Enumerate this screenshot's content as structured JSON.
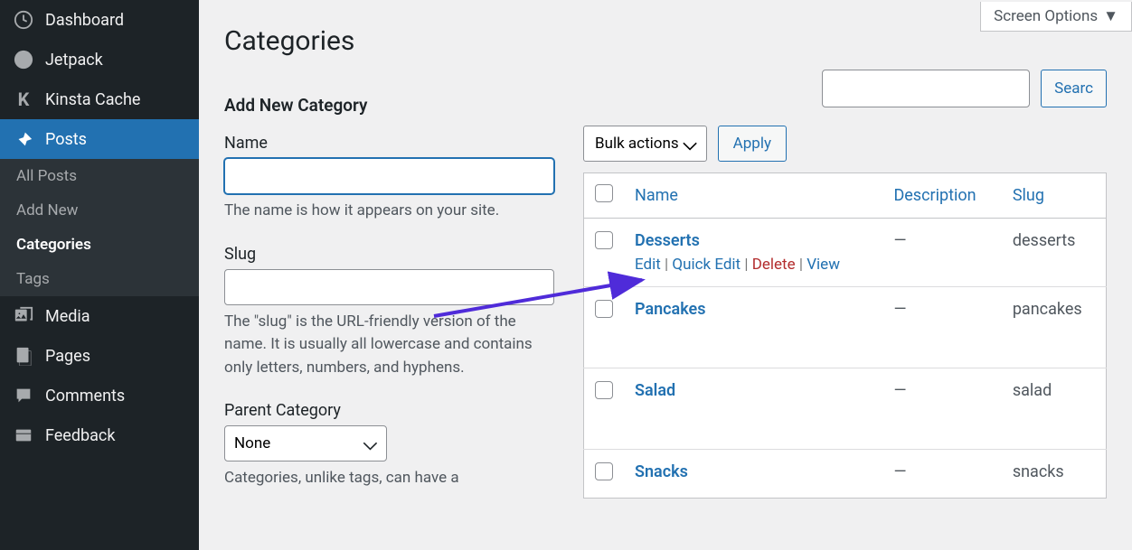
{
  "screen_options_label": "Screen Options",
  "page_title": "Categories",
  "sidebar": {
    "items": [
      {
        "label": "Dashboard",
        "icon": "dashboard"
      },
      {
        "label": "Jetpack",
        "icon": "jetpack"
      },
      {
        "label": "Kinsta Cache",
        "icon": "kinsta"
      },
      {
        "label": "Posts",
        "icon": "pin",
        "active": true
      },
      {
        "label": "Media",
        "icon": "media"
      },
      {
        "label": "Pages",
        "icon": "pages"
      },
      {
        "label": "Comments",
        "icon": "comment"
      },
      {
        "label": "Feedback",
        "icon": "feedback"
      }
    ],
    "posts_submenu": [
      {
        "label": "All Posts"
      },
      {
        "label": "Add New"
      },
      {
        "label": "Categories",
        "active": true
      },
      {
        "label": "Tags"
      }
    ]
  },
  "form": {
    "title": "Add New Category",
    "name_label": "Name",
    "name_value": "",
    "name_help": "The name is how it appears on your site.",
    "slug_label": "Slug",
    "slug_value": "",
    "slug_help": "The \"slug\" is the URL-friendly version of the name. It is usually all lowercase and contains only letters, numbers, and hyphens.",
    "parent_label": "Parent Category",
    "parent_value": "None",
    "parent_help": "Categories, unlike tags, can have a"
  },
  "search": {
    "button": "Searc"
  },
  "bulk": {
    "select_value": "Bulk actions",
    "apply_label": "Apply"
  },
  "table": {
    "headers": {
      "name": "Name",
      "description": "Description",
      "slug": "Slug"
    },
    "rows": [
      {
        "name": "Desserts",
        "description": "—",
        "slug": "desserts",
        "show_actions": true
      },
      {
        "name": "Pancakes",
        "description": "—",
        "slug": "pancakes"
      },
      {
        "name": "Salad",
        "description": "—",
        "slug": "salad"
      },
      {
        "name": "Snacks",
        "description": "—",
        "slug": "snacks"
      }
    ],
    "actions": {
      "edit": "Edit",
      "quick_edit": "Quick Edit",
      "delete": "Delete",
      "view": "View"
    }
  }
}
